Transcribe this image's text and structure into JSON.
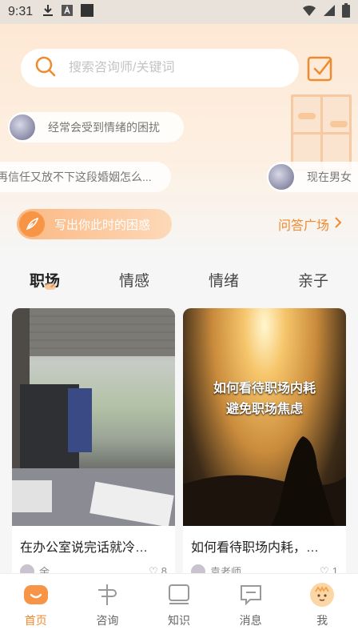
{
  "status_bar": {
    "time": "9:31"
  },
  "search": {
    "placeholder": "搜索咨询师/关键词"
  },
  "bubbles": [
    {
      "text": "经常会受到情绪的困扰"
    },
    {
      "text": "再信任又放不下这段婚姻怎么..."
    },
    {
      "text": "现在男女"
    }
  ],
  "write_button": {
    "label": "写出你此时的困惑"
  },
  "qa_link": {
    "label": "问答广场"
  },
  "tabs": [
    {
      "label": "职场"
    },
    {
      "label": "情感"
    },
    {
      "label": "情绪"
    },
    {
      "label": "亲子"
    }
  ],
  "cards": [
    {
      "title": "在办公室说完话就冷…",
      "author": "余…",
      "likes": "8"
    },
    {
      "title": "如何看待职场内耗，…",
      "image_caption_1": "如何看待职场内耗",
      "image_caption_2": "避免职场焦虑",
      "author": "袁老师",
      "likes": "1"
    }
  ],
  "bottom_nav": [
    {
      "label": "首页",
      "icon": "home-icon"
    },
    {
      "label": "咨询",
      "icon": "consult-icon"
    },
    {
      "label": "知识",
      "icon": "knowledge-icon"
    },
    {
      "label": "消息",
      "icon": "message-icon"
    },
    {
      "label": "我",
      "icon": "profile-icon"
    }
  ],
  "colors": {
    "accent": "#f08a2e",
    "header_bg": "#fde8d4"
  }
}
